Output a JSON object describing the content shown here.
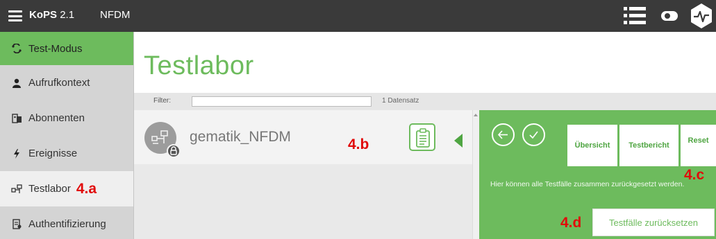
{
  "app": {
    "brand": "KoPS",
    "version": "2.1",
    "module": "NFDM"
  },
  "colors": {
    "accent": "#6dbb5d",
    "topbar": "#3a3a3a",
    "annotation": "#e10a0a"
  },
  "topbar_icons": [
    "menu-icon",
    "list-view-icon",
    "toggle-icon",
    "heart-pulse-icon"
  ],
  "sidebar": {
    "items": [
      {
        "label": "Test-Modus",
        "icon": "test-mode-icon"
      },
      {
        "label": "Aufrufkontext",
        "icon": "person-icon"
      },
      {
        "label": "Abonnenten",
        "icon": "subscribers-icon"
      },
      {
        "label": "Ereignisse",
        "icon": "bolt-icon"
      },
      {
        "label": "Testlabor",
        "icon": "testlab-icon",
        "annotation": "4.a"
      },
      {
        "label": "Authentifizierung",
        "icon": "auth-icon"
      }
    ]
  },
  "main": {
    "title": "Testlabor",
    "filter_label": "Filter:",
    "filter_value": "",
    "record_count": "1 Datensatz",
    "rows": [
      {
        "name": "gematik_NFDM",
        "annotation": "4.b"
      }
    ]
  },
  "panel": {
    "tabs": [
      {
        "label": "Übersicht"
      },
      {
        "label": "Testbericht"
      },
      {
        "label": "Reset",
        "active": true
      }
    ],
    "reset_annotation": "4.c",
    "description": "Hier können alle Testfälle zusammen zurückgesetzt werden.",
    "reset_button": "Testfälle zurücksetzen",
    "button_annotation": "4.d"
  }
}
